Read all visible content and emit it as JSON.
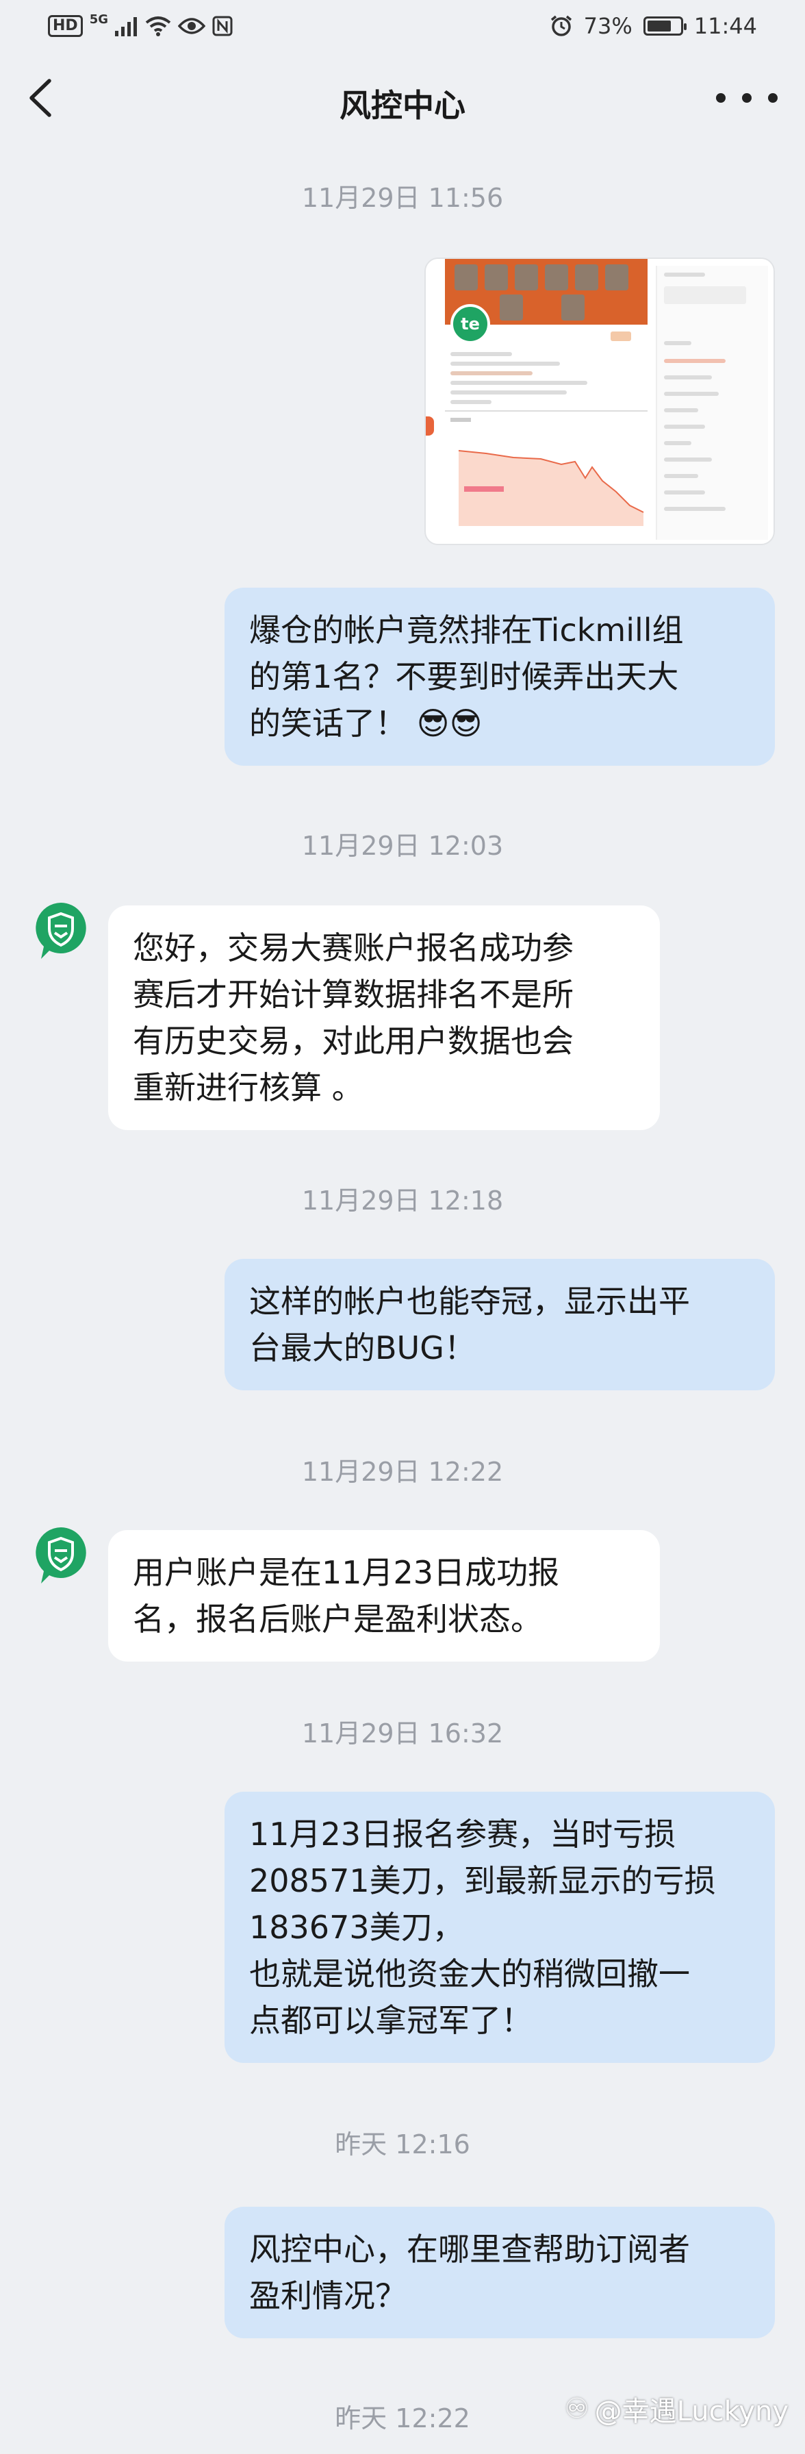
{
  "status_bar": {
    "left_labels": [
      "HD",
      "5G"
    ],
    "battery": "73%",
    "battery_level": 0.73,
    "time": "11:44",
    "icons": [
      "signal-icon",
      "wifi-icon",
      "eye-icon",
      "nfc-icon",
      "alarm-icon",
      "battery-icon"
    ]
  },
  "header": {
    "title": "风控中心",
    "back_icon": "chevron-left-icon",
    "more_icon": "more-dots-icon"
  },
  "messages": [
    {
      "type": "timestamp",
      "text": "11月29日 11:56"
    },
    {
      "type": "image",
      "sender": "me",
      "inner_avatar_text": "te"
    },
    {
      "type": "text",
      "sender": "me",
      "text": "爆仓的帐户竟然排在Tickmill组\n的第1名？不要到时候弄出天大\n的笑话了！ 😎😎"
    },
    {
      "type": "timestamp",
      "text": "11月29日 12:03"
    },
    {
      "type": "text",
      "sender": "them",
      "text": "您好，交易大赛账户报名成功参\n赛后才开始计算数据排名不是所\n有历史交易，对此用户数据也会\n重新进行核算 。"
    },
    {
      "type": "timestamp",
      "text": "11月29日 12:18"
    },
    {
      "type": "text",
      "sender": "me",
      "text": "这样的帐户也能夺冠，显示出平\n台最大的BUG！"
    },
    {
      "type": "timestamp",
      "text": "11月29日 12:22"
    },
    {
      "type": "text",
      "sender": "them",
      "text": "用户账户是在11月23日成功报\n名，报名后账户是盈利状态。"
    },
    {
      "type": "timestamp",
      "text": "11月29日 16:32"
    },
    {
      "type": "text",
      "sender": "me",
      "text": "11月23日报名参赛，当时亏损\n208571美刀，到最新显示的亏损\n183673美刀，\n也就是说他资金大的稍微回撤一\n点都可以拿冠军了！"
    },
    {
      "type": "timestamp",
      "text": "昨天 12:16"
    },
    {
      "type": "text",
      "sender": "me",
      "text": "风控中心，在哪里查帮助订阅者\n盈利情况？"
    },
    {
      "type": "timestamp",
      "text": "昨天 12:22"
    }
  ],
  "watermark": "@幸遇Luckyny",
  "colors": {
    "background": "#eef0f3",
    "my_bubble": "#d3e5f9",
    "their_bubble": "#ffffff",
    "avatar_green": "#1fa463",
    "timestamp": "#9a9ea6"
  }
}
